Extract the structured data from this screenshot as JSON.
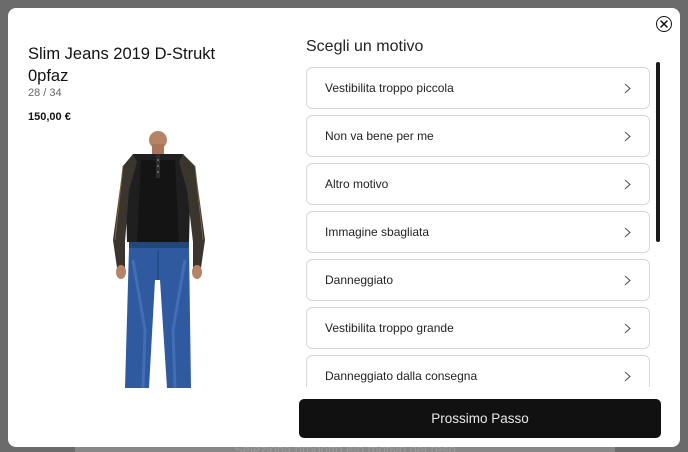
{
  "background": {
    "hint_text": "Seleziona prodotto e/o motivo del reso"
  },
  "modal": {
    "close_icon": "close-circle-icon",
    "product": {
      "title": "Slim Jeans 2019 D-Strukt 0pfaz",
      "count": "28 / 34",
      "price": "150,00 €"
    },
    "reasons_title": "Scegli un motivo",
    "reasons": [
      {
        "label": "Vestibilita troppo piccola"
      },
      {
        "label": "Non va bene per me"
      },
      {
        "label": "Altro motivo"
      },
      {
        "label": "Immagine sbagliata"
      },
      {
        "label": "Danneggiato"
      },
      {
        "label": "Vestibilita troppo grande"
      },
      {
        "label": "Danneggiato dalla consegna"
      }
    ],
    "next_button": "Prossimo Passo"
  },
  "colors": {
    "primary_button": "#111111",
    "border": "#d8d8d8",
    "backdrop": "#6b6b6b"
  }
}
